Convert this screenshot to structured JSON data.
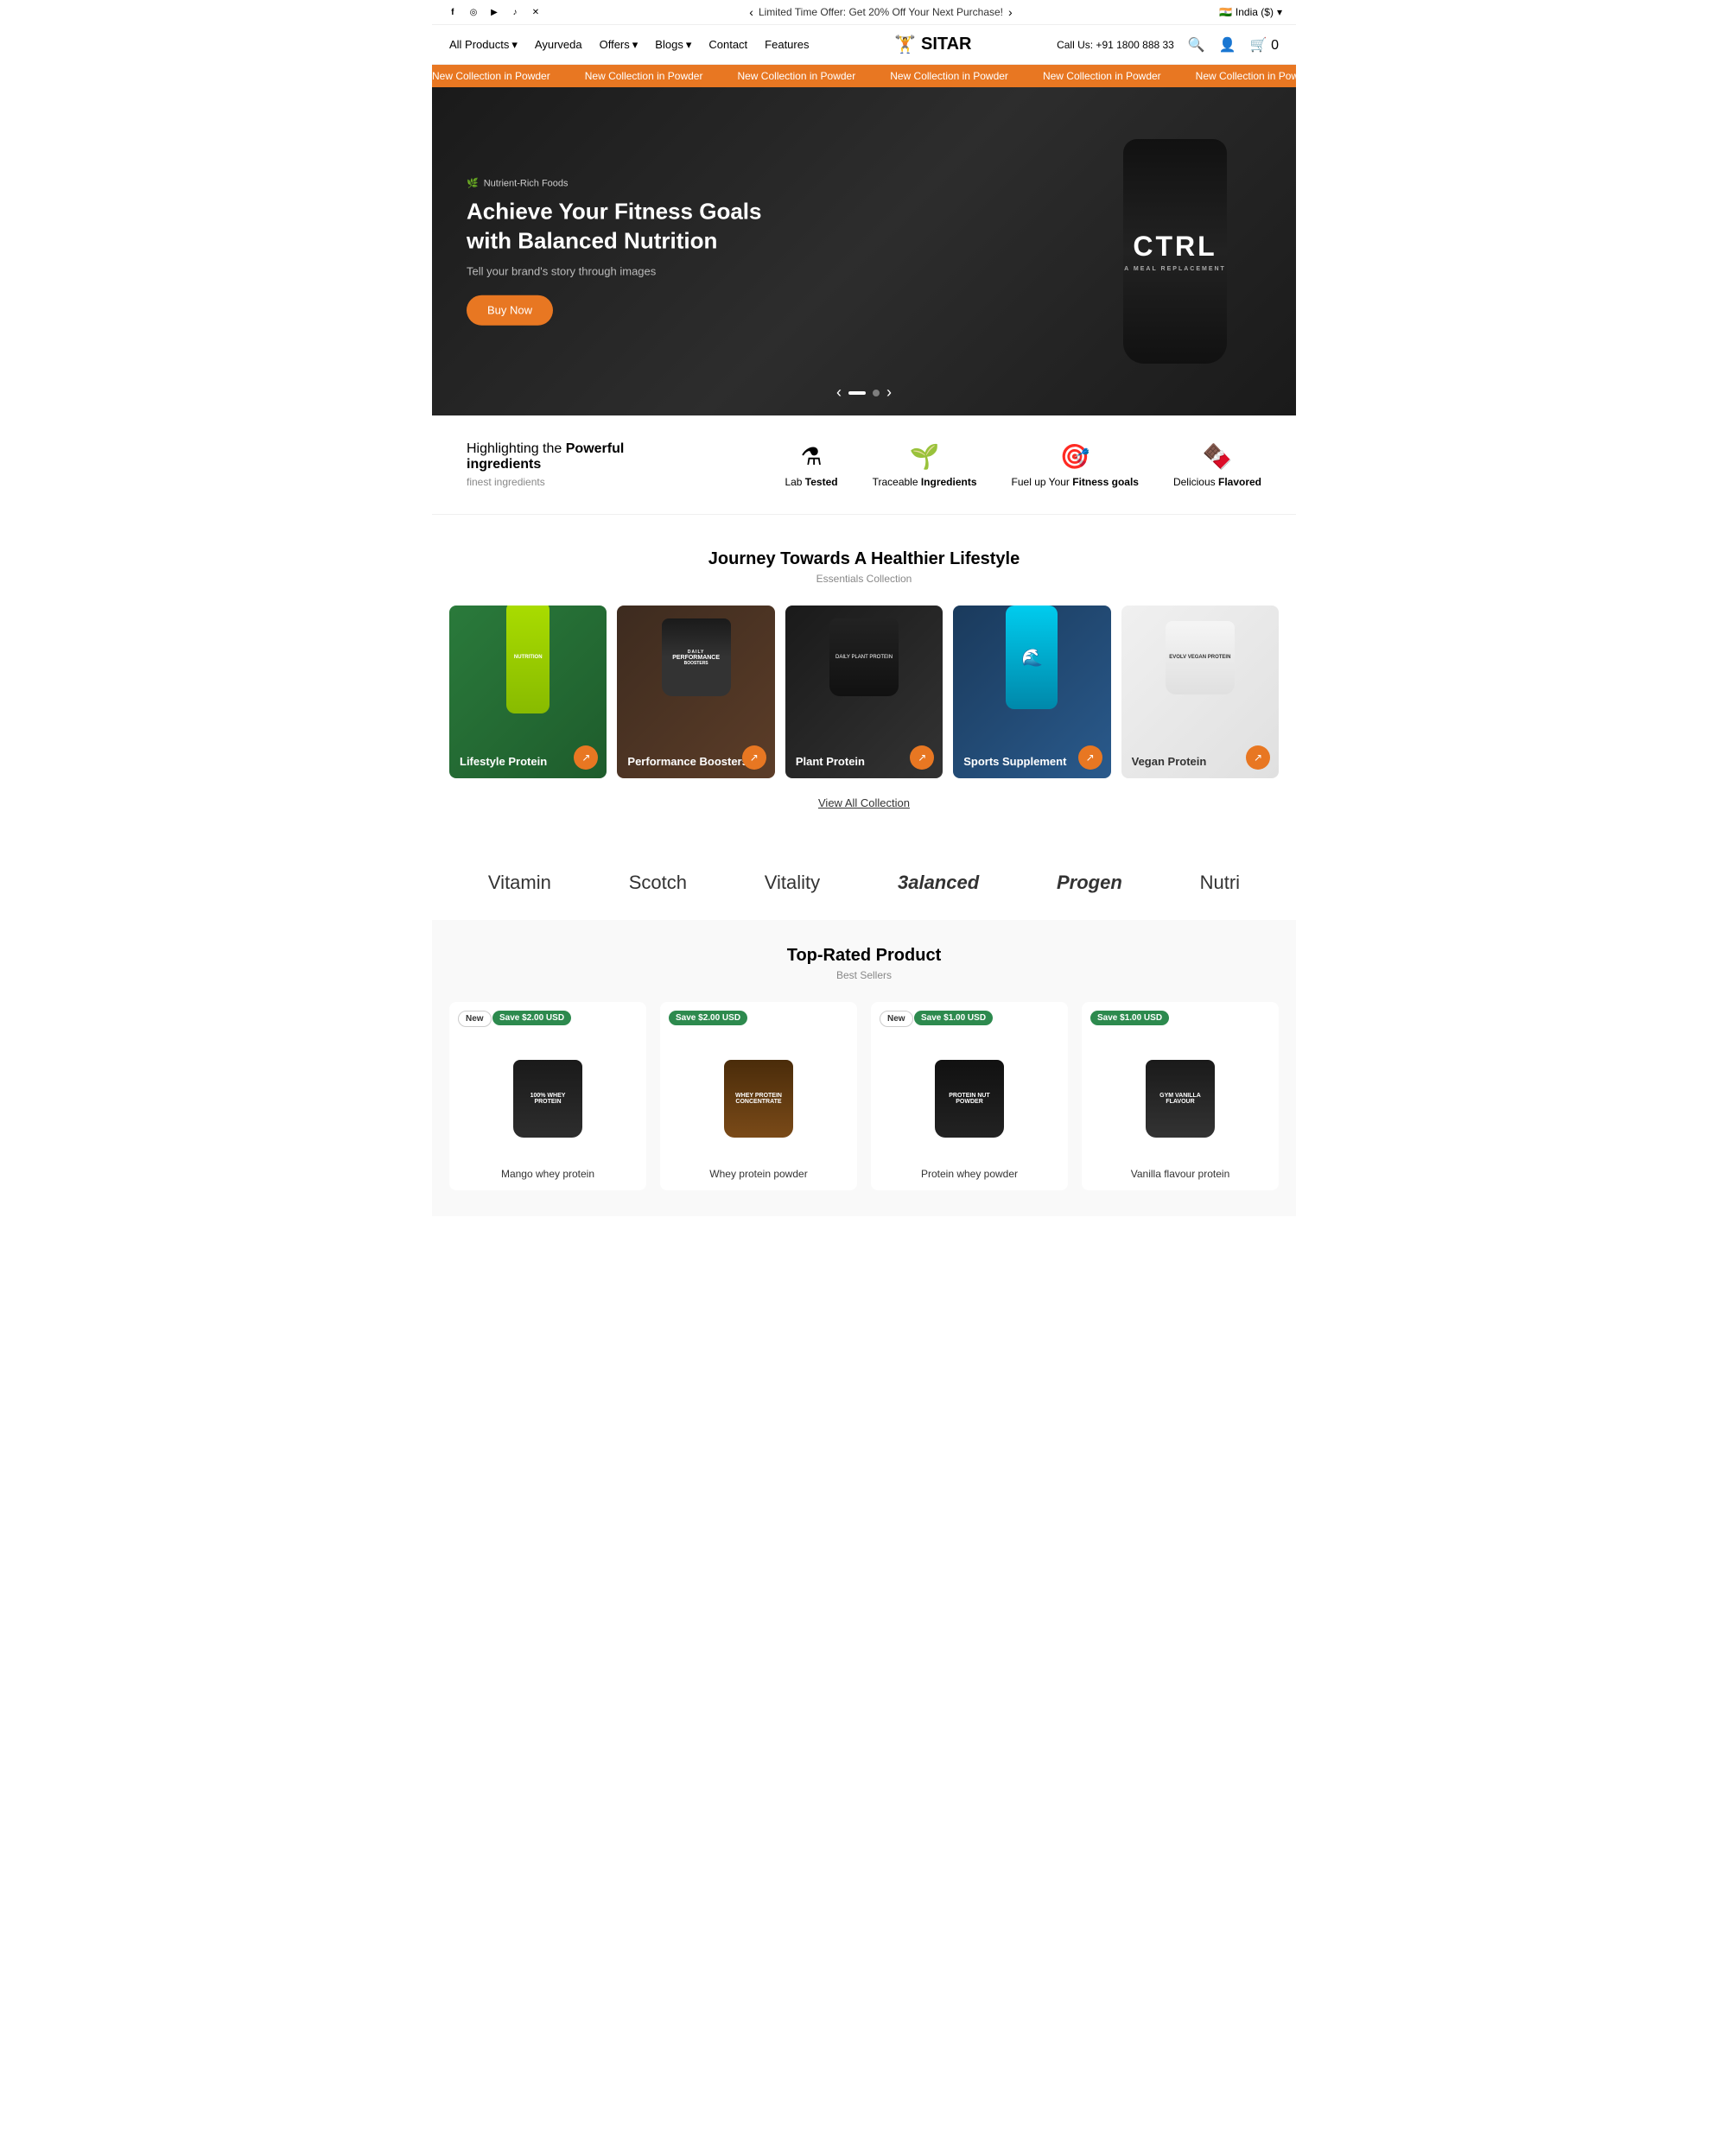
{
  "topBar": {
    "social": [
      "facebook",
      "instagram",
      "youtube",
      "tiktok",
      "twitter"
    ],
    "promo": "Limited Time Offer: Get 20% Off Your Next Purchase!",
    "country": "India ($)",
    "flag": "🇮🇳"
  },
  "nav": {
    "logo": "SITAR",
    "logoIcon": "🏋",
    "links": [
      {
        "label": "All Products",
        "hasDropdown": true
      },
      {
        "label": "Ayurveda",
        "hasDropdown": false
      },
      {
        "label": "Offers",
        "hasDropdown": true
      },
      {
        "label": "Blogs",
        "hasDropdown": true
      },
      {
        "label": "Contact",
        "hasDropdown": false
      },
      {
        "label": "Features",
        "hasDropdown": false
      }
    ],
    "phone": "Call Us: +91 1800 888 33",
    "cartCount": "0"
  },
  "ticker": {
    "items": [
      "New Collection in Powder",
      "New Collection in Powder",
      "New Collection in Powder",
      "New Collection in Powder",
      "New Collection in Powder",
      "New Collection in Powder",
      "New Collection in Powder",
      "New Collection in Powder"
    ]
  },
  "hero": {
    "badge": "Nutrient-Rich Foods",
    "title": "Achieve Your Fitness Goals with Balanced Nutrition",
    "subtitle": "Tell your brand's story through images",
    "cta": "Buy Now",
    "shakerText": "CTRL",
    "shakerSub": "A MEAL REPLACEMENT"
  },
  "features": {
    "heading": "Highlighting the",
    "headingBold": "Powerful ingredients",
    "sub": "finest ingredients",
    "items": [
      {
        "icon": "⚗",
        "label": "Lab",
        "labelBold": "Tested"
      },
      {
        "icon": "🌱",
        "label": "Traceable",
        "labelBold": "Ingredients"
      },
      {
        "icon": "🎯",
        "label": "Fuel up Your",
        "labelBold": "Fitness goals"
      },
      {
        "icon": "🍫",
        "label": "Delicious",
        "labelBold": "Flavored"
      }
    ]
  },
  "collection": {
    "title": "Journey Towards A Healthier Lifestyle",
    "sub": "Essentials Collection",
    "items": [
      {
        "label": "Lifestyle Protein",
        "bg": "1"
      },
      {
        "label": "Performance Boosters",
        "bg": "2"
      },
      {
        "label": "Plant Protein",
        "bg": "3"
      },
      {
        "label": "Sports Supplement",
        "bg": "4"
      },
      {
        "label": "Vegan Protein",
        "bg": "5"
      }
    ],
    "viewAll": "View All Collection"
  },
  "brands": {
    "items": [
      "Vitamin",
      "Scotch",
      "Vitality",
      "3alanced",
      "Progen",
      "Nutri"
    ]
  },
  "topRated": {
    "title": "Top-Rated Product",
    "sub": "Best Sellers",
    "products": [
      {
        "name": "Mango whey protein",
        "badge": "New",
        "badgeType": "new",
        "save": "Save $2.00 USD",
        "text": "100% WHEY PROTEIN"
      },
      {
        "name": "Whey protein powder",
        "badge": "Save $2.00 USD",
        "badgeType": "save",
        "text": "WHEY PROTEIN CONCENTRATE"
      },
      {
        "name": "Protein whey powder",
        "badge": "New",
        "badgeType": "new",
        "save": "Save $1.00 USD",
        "text": "PROTEIN NUT POWDER"
      },
      {
        "name": "Vanilla flavour protein",
        "badge": "Save $1.00 USD",
        "badgeType": "save",
        "text": "GYM VANILLA FLAVOUR"
      }
    ]
  }
}
